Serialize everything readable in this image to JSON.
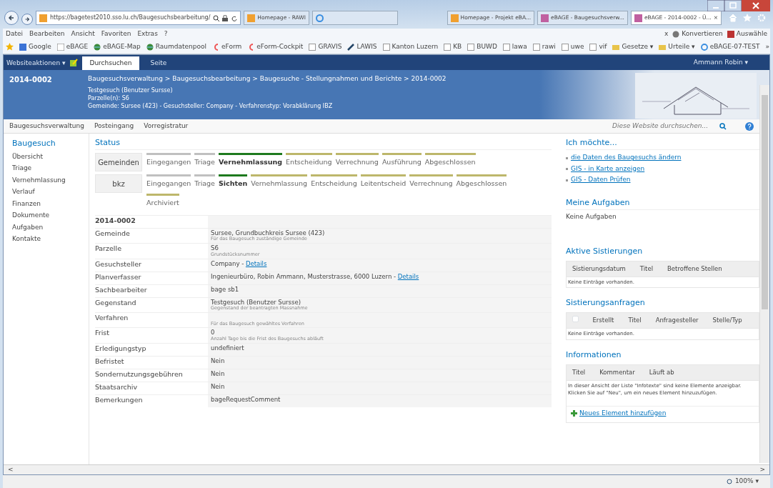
{
  "browser": {
    "address": "https://bagetest2010.sso.lu.ch/Baugesuchsbearbeitung/",
    "scroll_left": "<",
    "scroll_right": ">",
    "tabs": [
      {
        "label": "Homepage - RAWI",
        "selected": false
      },
      {
        "selected": false
      },
      {
        "label": "Homepage - Projekt eBA...",
        "selected": false
      },
      {
        "label": "eBAGE - Baugesuchsverw...",
        "selected": false
      },
      {
        "label": "eBAGE - 2014-0002 - Ü...",
        "selected": true
      }
    ],
    "tab_close": "×",
    "menu": [
      "Datei",
      "Bearbeiten",
      "Ansicht",
      "Favoriten",
      "Extras",
      "?"
    ],
    "menu_right": {
      "close": "x",
      "convert": "Konvertieren",
      "select": "Auswähle"
    },
    "favorites": [
      {
        "label": "Google",
        "kind": "google"
      },
      {
        "label": "eBAGE",
        "kind": "app"
      },
      {
        "label": "eBAGE-Map",
        "kind": "globe"
      },
      {
        "label": "Raumdatenpool",
        "kind": "globe"
      },
      {
        "label": "eForm",
        "kind": "eform"
      },
      {
        "label": "eForm-Cockpit",
        "kind": "eform"
      },
      {
        "label": "GRAVIS",
        "kind": "page"
      },
      {
        "label": "LAWIS",
        "kind": "pen"
      },
      {
        "label": "Kanton Luzern",
        "kind": "page"
      },
      {
        "label": "KB",
        "kind": "page"
      },
      {
        "label": "BUWD",
        "kind": "page"
      },
      {
        "label": "lawa",
        "kind": "page"
      },
      {
        "label": "rawi",
        "kind": "page"
      },
      {
        "label": "uwe",
        "kind": "page"
      },
      {
        "label": "vif",
        "kind": "page"
      },
      {
        "label": "Gesetze ▾",
        "kind": "folder"
      },
      {
        "label": "Urteile ▾",
        "kind": "folder"
      },
      {
        "label": "eBAGE-07-TEST",
        "kind": "ie"
      }
    ],
    "favorites_more": "»",
    "zoom": "100%  ▾"
  },
  "ribbon": {
    "site_actions": "Websiteaktionen ▾",
    "tabs": [
      {
        "label": "Durchsuchen",
        "selected": true
      },
      {
        "label": "Seite",
        "selected": false
      }
    ],
    "user": "Ammann Robin ▾"
  },
  "header": {
    "id": "2014-0002",
    "breadcrumb": "Baugesuchsverwaltung > Baugesuchsbearbeitung > Baugesuche - Stellungnahmen und Berichte > 2014-0002",
    "lines": [
      "Testgesuch (Benutzer Sursse)",
      "Parzelle(n): S6",
      "Gemeinde: Sursee (423) - Gesuchsteller: Company - Verfahrenstyp: Vorabklärung IBZ"
    ]
  },
  "topnav": {
    "items": [
      "Baugesuchsverwaltung",
      "Posteingang",
      "Vorregistratur"
    ],
    "search_placeholder": "Diese Website durchsuchen..."
  },
  "sidebar": {
    "title": "Baugesuch",
    "items": [
      "Übersicht",
      "Triage",
      "Vernehmlassung",
      "Verlauf",
      "Finanzen",
      "Dokumente",
      "Aufgaben",
      "Kontakte"
    ]
  },
  "status": {
    "title": "Status",
    "tracks": [
      {
        "name": "Gemeinden",
        "steps": [
          {
            "label": "Eingegangen",
            "current": false,
            "color": "#c0c0c0"
          },
          {
            "label": "Triage",
            "current": false,
            "color": "#c0c0c0"
          },
          {
            "label": "Vernehmlassung",
            "current": true,
            "color": "#1e7a1e"
          },
          {
            "label": "Entscheidung",
            "current": false,
            "color": "#bdb76b"
          },
          {
            "label": "Verrechnung",
            "current": false,
            "color": "#bdb76b"
          },
          {
            "label": "Ausführung",
            "current": false,
            "color": "#bdb76b"
          },
          {
            "label": "Abgeschlossen",
            "current": false,
            "color": "#bdb76b"
          }
        ]
      },
      {
        "name": "bkz",
        "steps": [
          {
            "label": "Eingegangen",
            "current": false,
            "color": "#c0c0c0"
          },
          {
            "label": "Triage",
            "current": false,
            "color": "#c0c0c0"
          },
          {
            "label": "Sichten",
            "current": true,
            "color": "#1e7a1e"
          },
          {
            "label": "Vernehmlassung",
            "current": false,
            "color": "#bdb76b"
          },
          {
            "label": "Entscheidung",
            "current": false,
            "color": "#bdb76b"
          },
          {
            "label": "Leitentscheid",
            "current": false,
            "color": "#bdb76b"
          },
          {
            "label": "Verrechnung",
            "current": false,
            "color": "#bdb76b"
          },
          {
            "label": "Abgeschlossen",
            "current": false,
            "color": "#bdb76b"
          },
          {
            "label": "Archiviert",
            "current": false,
            "color": "#bdb76b"
          }
        ]
      }
    ]
  },
  "details": {
    "title": "2014-0002",
    "rows": [
      {
        "label": "Gemeinde",
        "value": "Sursee, Grundbuchkreis Sursee (423)",
        "hint": "Für das Baugesuch zuständige Gemeinde"
      },
      {
        "label": "Parzelle",
        "value": "S6",
        "hint": "Grundstücksnummer"
      },
      {
        "label": "Gesuchsteller",
        "value": "Company -",
        "link": "Details"
      },
      {
        "label": "Planverfasser",
        "value": "Ingenieurbüro, Robin Ammann, Musterstrasse, 6000 Luzern -",
        "link": "Details"
      },
      {
        "label": "Sachbearbeiter",
        "value": "bage sb1"
      },
      {
        "label": "Gegenstand",
        "value": "Testgesuch (Benutzer Sursse)",
        "hint": "Gegenstand der beantragten Massnahme"
      },
      {
        "label": "Verfahren",
        "hint": "Für das Baugesuch gewähltes Verfahren"
      },
      {
        "label": "Frist",
        "value": "0",
        "hint": "Anzahl Tage bis die Frist des Baugesuchs abläuft"
      },
      {
        "label": "Erledigungstyp",
        "value": "undefiniert"
      },
      {
        "label": "Befristet",
        "value": "Nein"
      },
      {
        "label": "Sondernutzungsgebühren",
        "value": "Nein"
      },
      {
        "label": "Staatsarchiv",
        "value": "Nein"
      },
      {
        "label": "Bemerkungen",
        "value": "bageRequestComment"
      }
    ]
  },
  "right": {
    "ich_moechte": {
      "title": "Ich möchte...",
      "links": [
        "die Daten des Baugesuchs ändern",
        "GIS - in Karte anzeigen",
        "GIS - Daten Prüfen"
      ]
    },
    "aufgaben": {
      "title": "Meine Aufgaben",
      "text": "Keine Aufgaben"
    },
    "sistierungen": {
      "title": "Aktive Sistierungen",
      "columns": [
        "Sistierungsdatum",
        "Titel",
        "Betroffene Stellen"
      ],
      "empty": "Keine Einträge vorhanden."
    },
    "anfragen": {
      "title": "Sistierungsanfragen",
      "checked": false,
      "columns": [
        "Erstellt",
        "Titel",
        "Anfragesteller",
        "Stelle/Typ"
      ],
      "empty": "Keine Einträge vorhanden."
    },
    "informationen": {
      "title": "Informationen",
      "columns": [
        "Titel",
        "Kommentar",
        "Läuft ab"
      ],
      "empty": "In dieser Ansicht der Liste \"Infotexte\" sind keine Elemente anzeigbar. Klicken Sie auf \"Neu\", um ein neues Element hinzuzufügen.",
      "add": "Neues Element hinzufügen"
    }
  }
}
